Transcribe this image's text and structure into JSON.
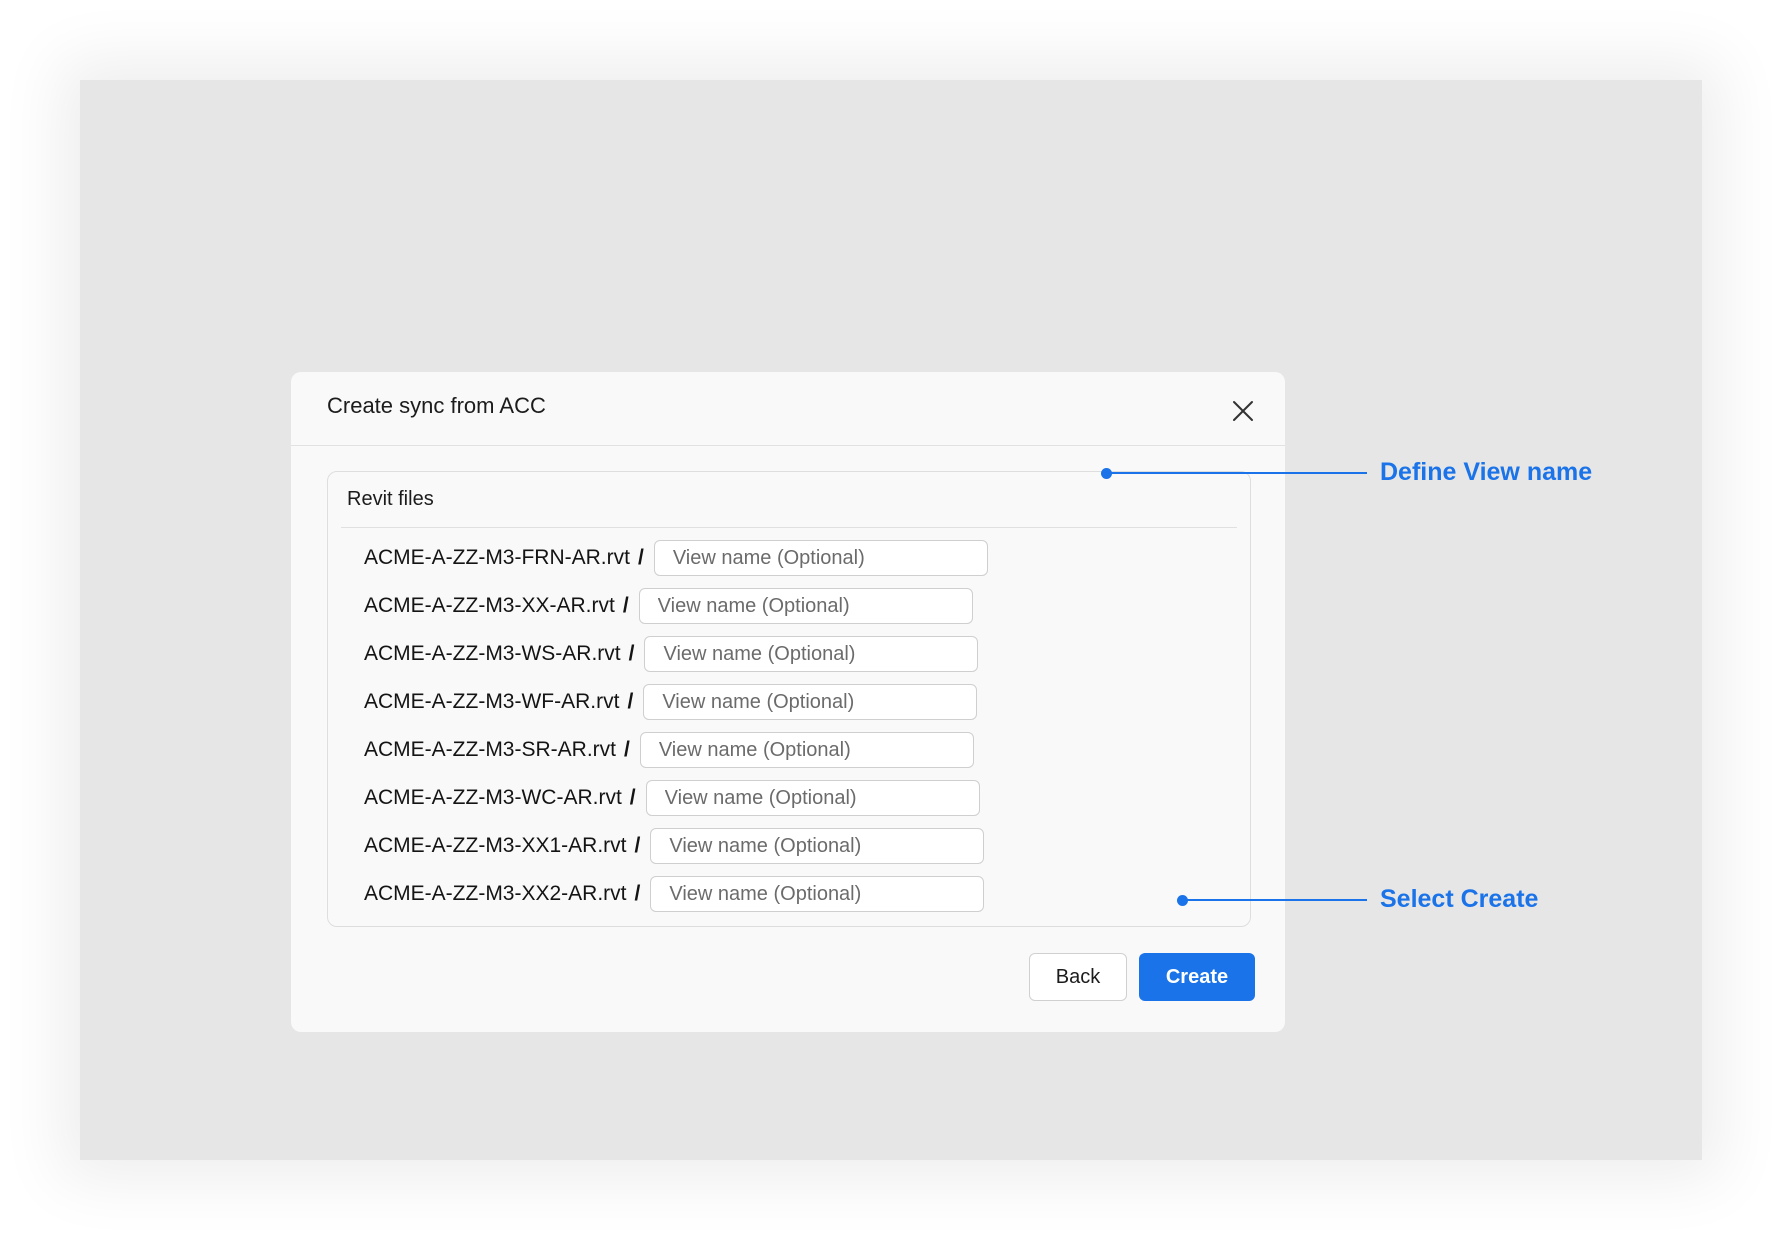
{
  "dialog": {
    "title": "Create sync from ACC",
    "close_icon": "close-icon"
  },
  "files_panel": {
    "title": "Revit files",
    "separator": "/",
    "rows": [
      {
        "file": "ACME-A-ZZ-M3-FRN-AR.rvt",
        "placeholder": "View name (Optional)",
        "value": ""
      },
      {
        "file": "ACME-A-ZZ-M3-XX-AR.rvt",
        "placeholder": "View name (Optional)",
        "value": ""
      },
      {
        "file": "ACME-A-ZZ-M3-WS-AR.rvt",
        "placeholder": "View name (Optional)",
        "value": ""
      },
      {
        "file": "ACME-A-ZZ-M3-WF-AR.rvt",
        "placeholder": "View name (Optional)",
        "value": ""
      },
      {
        "file": "ACME-A-ZZ-M3-SR-AR.rvt",
        "placeholder": "View name (Optional)",
        "value": ""
      },
      {
        "file": "ACME-A-ZZ-M3-WC-AR.rvt",
        "placeholder": "View name (Optional)",
        "value": ""
      },
      {
        "file": "ACME-A-ZZ-M3-XX1-AR.rvt",
        "placeholder": "View name (Optional)",
        "value": ""
      },
      {
        "file": "ACME-A-ZZ-M3-XX2-AR.rvt",
        "placeholder": "View name (Optional)",
        "value": ""
      }
    ]
  },
  "buttons": {
    "back_label": "Back",
    "create_label": "Create"
  },
  "callouts": {
    "define_view_name": "Define View name",
    "select_create": "Select Create"
  },
  "colors": {
    "accent": "#1a73e8",
    "dialog_bg": "#f9f9f9",
    "canvas_bg": "#e6e6e6"
  }
}
